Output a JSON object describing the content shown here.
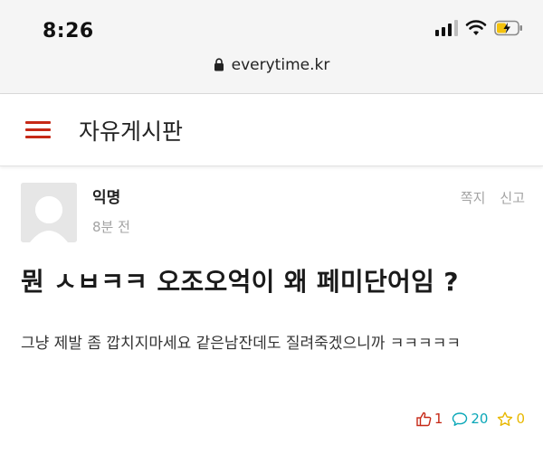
{
  "status_bar": {
    "time": "8:26"
  },
  "browser": {
    "url": "everytime.kr"
  },
  "board": {
    "title": "자유게시판"
  },
  "post": {
    "author": "익명",
    "time_ago": "8분 전",
    "actions": {
      "message": "쪽지",
      "report": "신고"
    },
    "title": "뭔 ㅅㅂㅋㅋ 오조오억이 왜 페미단어임 ?",
    "body": "그냥 제발 좀 깝치지마세요 같은남잔데도 질려죽겠으니까 ㅋㅋㅋㅋㅋ",
    "stats": {
      "likes": "1",
      "comments": "20",
      "scraps": "0"
    }
  },
  "colors": {
    "accent_red": "#c62917",
    "comment_teal": "#0aa7b8",
    "scrap_yellow": "#e8b800",
    "muted_gray": "#a3a3a3"
  },
  "icons": [
    "lock-icon",
    "signal-icon",
    "wifi-icon",
    "battery-icon",
    "hamburger-menu-icon",
    "avatar-icon",
    "thumbs-up-icon",
    "comment-icon",
    "star-icon"
  ]
}
